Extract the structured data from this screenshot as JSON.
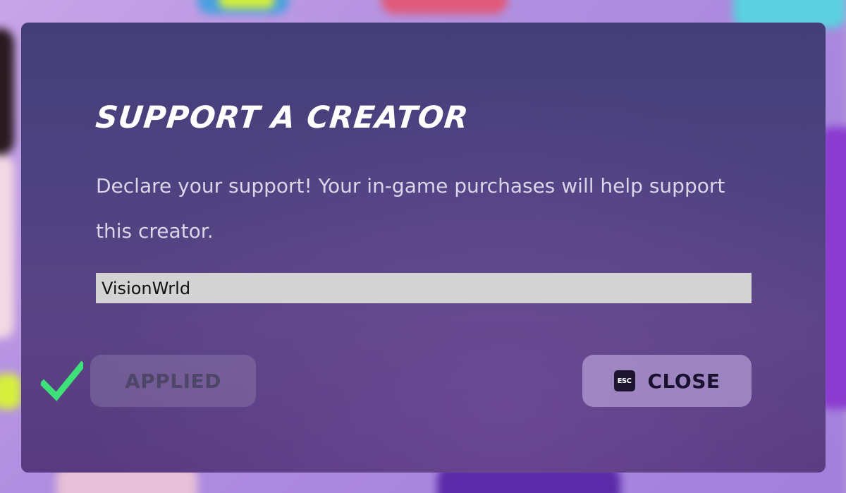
{
  "dialog": {
    "title": "SUPPORT A CREATOR",
    "description": "Declare your support! Your in-game purchases will help support this creator.",
    "creator_input": {
      "value": "VisionWrld"
    },
    "applied_button": {
      "label": "APPLIED",
      "status_icon": "check-icon"
    },
    "close_button": {
      "label": "CLOSE",
      "key_hint": "ESC"
    }
  },
  "colors": {
    "dialog_bg": "#4d4280",
    "title": "#ffffff",
    "description": "#dcd5ea",
    "input_bg": "#d3d3d3",
    "check": "#3ee07a",
    "close_label": "#1a1030"
  }
}
